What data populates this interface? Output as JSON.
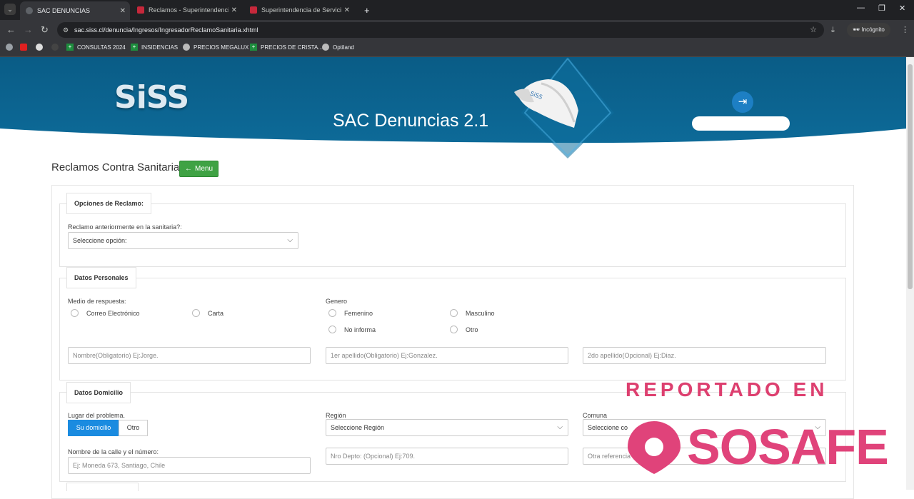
{
  "browser": {
    "tabs": [
      {
        "title": "SAC DENUNCIAS",
        "fav_color": "#5f6368"
      },
      {
        "title": "Reclamos - Superintendencia de",
        "fav_color": "#d33"
      },
      {
        "title": "Superintendencia de Servicios",
        "fav_color": "#d33"
      }
    ],
    "new_tab": "+",
    "url": "sac.siss.cl/denuncia/Ingresos/IngresadorReclamoSanitaria.xhtml",
    "incognito_label": "Incógnito",
    "bookmarks": [
      {
        "label": "CONSULTAS 2024"
      },
      {
        "label": "INSIDENCIAS"
      },
      {
        "label": "PRECIOS MEGALUX"
      },
      {
        "label": "PRECIOS DE CRISTA..."
      },
      {
        "label": "Optiland"
      }
    ]
  },
  "header": {
    "logo_text": "SiSS",
    "app_title": "SAC Denuncias 2.1"
  },
  "page": {
    "title": "Reclamos Contra Sanitaria",
    "menu_button": "Menu"
  },
  "opciones": {
    "legend": "Opciones de Reclamo:",
    "label": "Reclamo anteriormente en la sanitaria?:",
    "select_value": "Seleccione opción:"
  },
  "personales": {
    "legend": "Datos Personales",
    "medio_label": "Medio de respuesta:",
    "medio_options": [
      "Correo Electrónico",
      "Carta"
    ],
    "genero_label": "Genero",
    "genero_options": [
      "Femenino",
      "Masculino",
      "No informa",
      "Otro"
    ],
    "nombre_placeholder": "Nombre(Obligatorio) Ej:Jorge.",
    "apellido1_placeholder": "1er apellido(Obligatorio) Ej:Gonzalez.",
    "apellido2_placeholder": "2do apellido(Opcional) Ej:Diaz."
  },
  "domicilio": {
    "legend": "Datos Domicilio",
    "lugar_label": "Lugar del problema.",
    "lugar_options": [
      "Su domicilio",
      "Otro"
    ],
    "region_label": "Región",
    "region_value": "Seleccione Región",
    "comuna_label": "Comuna",
    "comuna_value": "Seleccione co",
    "calle_label": "Nombre de la calle y el número:",
    "calle_placeholder": "Ej: Moneda 673, Santiago, Chile",
    "depto_placeholder": "Nro Depto: (Opcional) Ej:709.",
    "referencia_placeholder": "Otra referencia"
  },
  "watermark": {
    "line1": "REPORTADO EN",
    "line2": "SOSAFE",
    "color": "#e0437a"
  }
}
